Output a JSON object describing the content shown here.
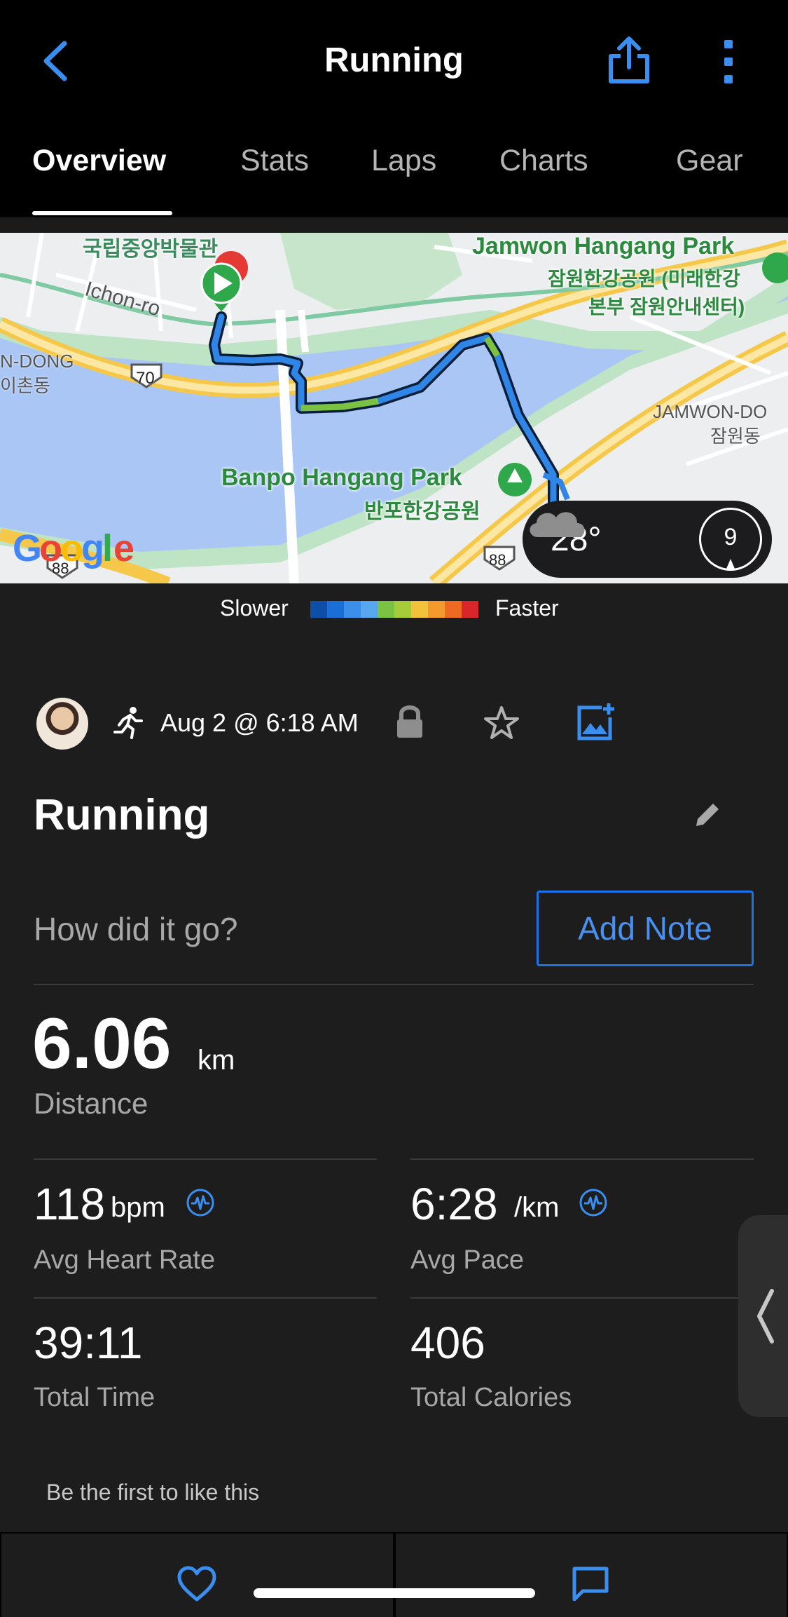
{
  "header": {
    "title": "Running",
    "back_icon": "chevron-left-icon",
    "share_icon": "share-icon",
    "more_icon": "more-vertical-icon"
  },
  "tabs": [
    {
      "label": "Overview",
      "active": true
    },
    {
      "label": "Stats",
      "active": false
    },
    {
      "label": "Laps",
      "active": false
    },
    {
      "label": "Charts",
      "active": false
    },
    {
      "label": "Gear",
      "active": false
    }
  ],
  "map": {
    "labels": {
      "museum": "국립중앙박물관",
      "ichon_ro": "Ichon-ro",
      "n_dong": "N-DONG",
      "chon_dong": "이촌동",
      "jamwon_park": "Jamwon Hangang Park",
      "jamwon_park_kr1": "잠원한강공원 (미래한강",
      "jamwon_park_kr2": "본부 잠원안내센터)",
      "jamwon_dong": "JAMWON-DO",
      "jamwon_dong_kr": "잠원동",
      "banpo_park": "Banpo Hangang Park",
      "banpo_park_kr": "반포한강공원",
      "route_70": "70",
      "route_88a": "88",
      "route_88b": "88",
      "google": "Google"
    },
    "weather": {
      "temperature": "28°",
      "icon": "cloud-icon",
      "wind": "9"
    }
  },
  "legend": {
    "slower": "Slower",
    "faster": "Faster",
    "colors": [
      "#0d4fa8",
      "#1a6fd6",
      "#3b8fe8",
      "#58a6ee",
      "#7cc242",
      "#a7cc3a",
      "#f4c13a",
      "#f39a2e",
      "#ee6a22",
      "#d8262a"
    ]
  },
  "activity": {
    "date": "Aug 2 @ 6:18 AM",
    "title": "Running",
    "note_prompt": "How did it go?",
    "add_note": "Add Note"
  },
  "stats": {
    "distance_value": "6.06",
    "distance_unit": "km",
    "distance_label": "Distance",
    "hr_value": "118",
    "hr_unit": "bpm",
    "hr_label": "Avg Heart Rate",
    "pace_value": "6:28",
    "pace_unit": "/km",
    "pace_label": "Avg Pace",
    "time_value": "39:11",
    "time_label": "Total Time",
    "calories_value": "406",
    "calories_label": "Total Calories"
  },
  "social": {
    "like_text": "Be the first to like this"
  },
  "colors": {
    "accent": "#1a73e8",
    "background": "#1d1d1d"
  }
}
